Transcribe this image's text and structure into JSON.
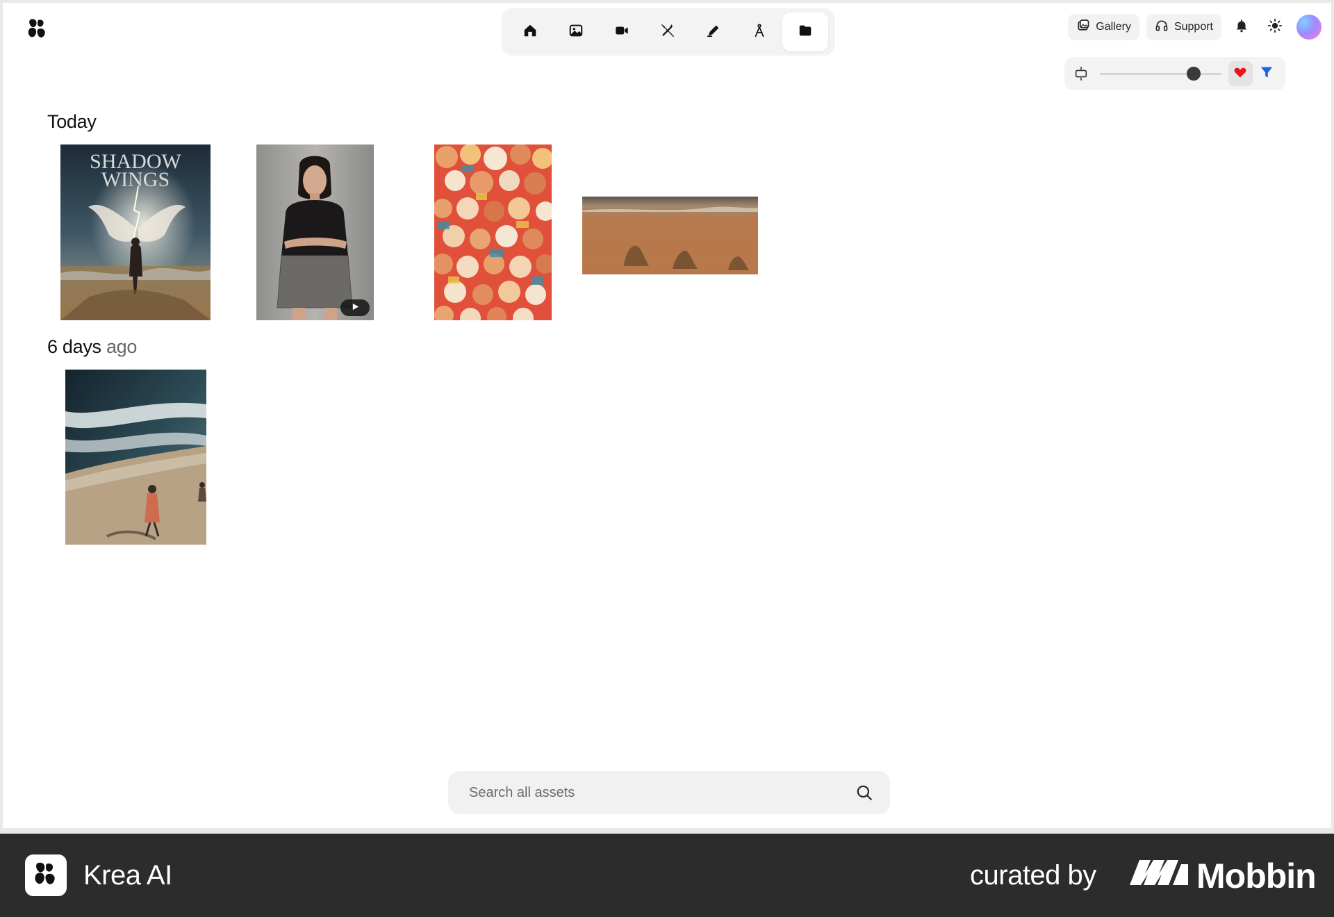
{
  "nav": {
    "items": [
      {
        "name": "home",
        "icon": "home-icon",
        "active": false
      },
      {
        "name": "image",
        "icon": "image-icon",
        "active": false
      },
      {
        "name": "video",
        "icon": "video-camera-icon",
        "active": false
      },
      {
        "name": "enhance",
        "icon": "magic-wand-icon",
        "active": false
      },
      {
        "name": "edit",
        "icon": "pen-icon",
        "active": false
      },
      {
        "name": "train",
        "icon": "compass-icon",
        "active": false
      },
      {
        "name": "assets",
        "icon": "folder-icon",
        "active": true
      }
    ]
  },
  "header": {
    "gallery_label": "Gallery",
    "support_label": "Support"
  },
  "viewbar": {
    "thumbnail_size": 0.77,
    "favorites_color": "#e8141d",
    "filter_color": "#1565e0"
  },
  "sections": {
    "today": {
      "title": "Today"
    },
    "older": {
      "title_strong": "6 days",
      "title_muted": "ago"
    }
  },
  "assets": {
    "poster_title_line1": "SHADOW",
    "poster_title_line2": "WINGS"
  },
  "search": {
    "placeholder": "Search all assets"
  },
  "footer": {
    "app_name": "Krea AI",
    "curated_by": "curated by",
    "brand": "Mobbin"
  }
}
